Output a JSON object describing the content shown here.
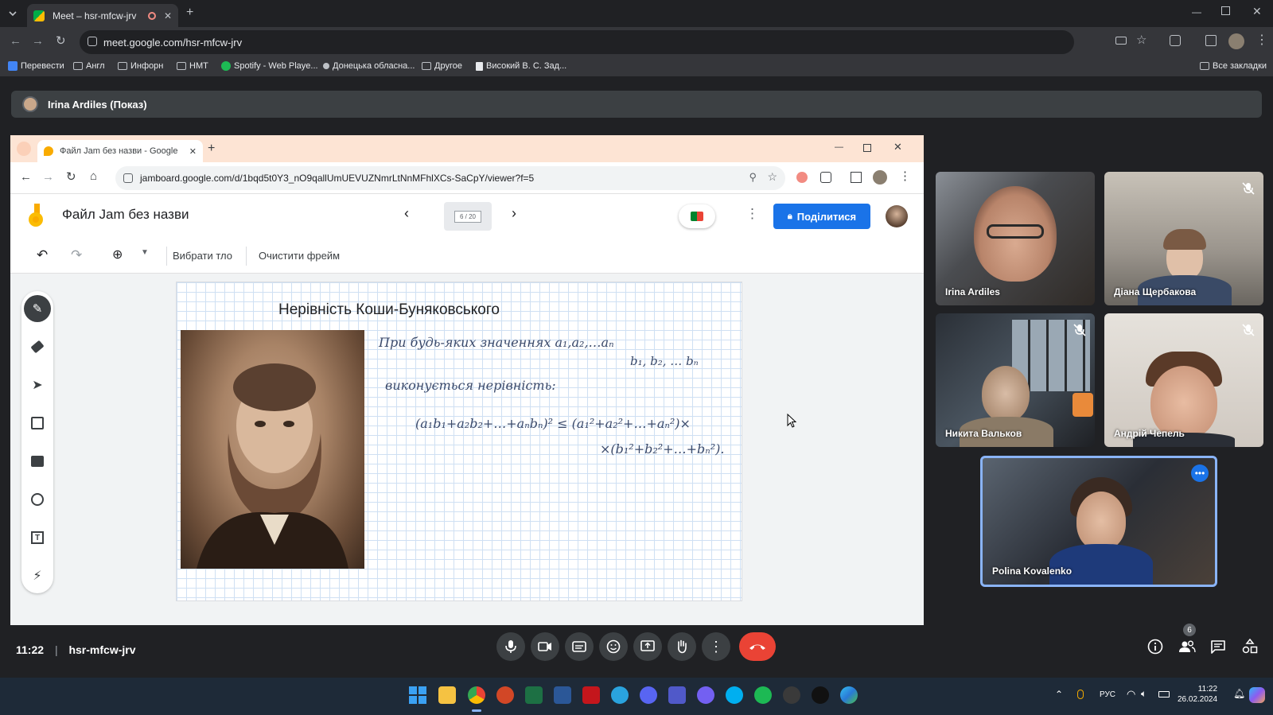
{
  "browser": {
    "tab_title": "Meet – hsr-mfcw-jrv",
    "url": "meet.google.com/hsr-mfcw-jrv",
    "bookmarks": [
      "Перевести",
      "Англ",
      "Инфорн",
      "НМТ",
      "Spotify - Web Playe...",
      "Донецька обласна...",
      "Другое",
      "Високий В. С. Зад..."
    ],
    "all_bookmarks": "Все закладки"
  },
  "presenter": {
    "label": "Irina Ardiles (Показ)"
  },
  "shared": {
    "tab_title": "Файл Jam без назви - Google",
    "url": "jamboard.google.com/d/1bqd5t0Y3_nO9qallUmUEVUZNmrLtNnMFhlXCs-SaCpY/viewer?f=5",
    "doc_title": "Файл Jam без назви",
    "frame_counter": "6 / 20",
    "share_label": "Поділитися",
    "toolbar": {
      "background": "Вибрати тло",
      "clear": "Очистити фрейм"
    },
    "frame_title": "Нерівність Коши-Буняковського",
    "handwriting": {
      "line1": "При будь-яких значеннях  a₁,a₂,…aₙ",
      "line1b": "b₁, b₂, … bₙ",
      "line2": "виконується нерівність:",
      "line3": "(a₁b₁+a₂b₂+…+aₙbₙ)² ≤ (a₁²+a₂²+…+aₙ²)×",
      "line4": "×(b₁²+b₂²+…+bₙ²)."
    }
  },
  "participants": [
    {
      "name": "Irina Ardiles",
      "muted": false
    },
    {
      "name": "Діана Щербакова",
      "muted": true
    },
    {
      "name": "Никита Вальков",
      "muted": true
    },
    {
      "name": "Андрій Чепель",
      "muted": true
    },
    {
      "name": "Polina Kovalenko",
      "muted": false
    }
  ],
  "meeting": {
    "time": "11:22",
    "separator": "|",
    "code": "hsr-mfcw-jrv",
    "participant_count": "6"
  },
  "taskbar": {
    "lang": "РУС",
    "clock_time": "11:22",
    "clock_date": "26.02.2024"
  },
  "colors": {
    "accent": "#1a73e8",
    "end_call": "#ea4335",
    "speaker_border": "#8ab4f8"
  }
}
